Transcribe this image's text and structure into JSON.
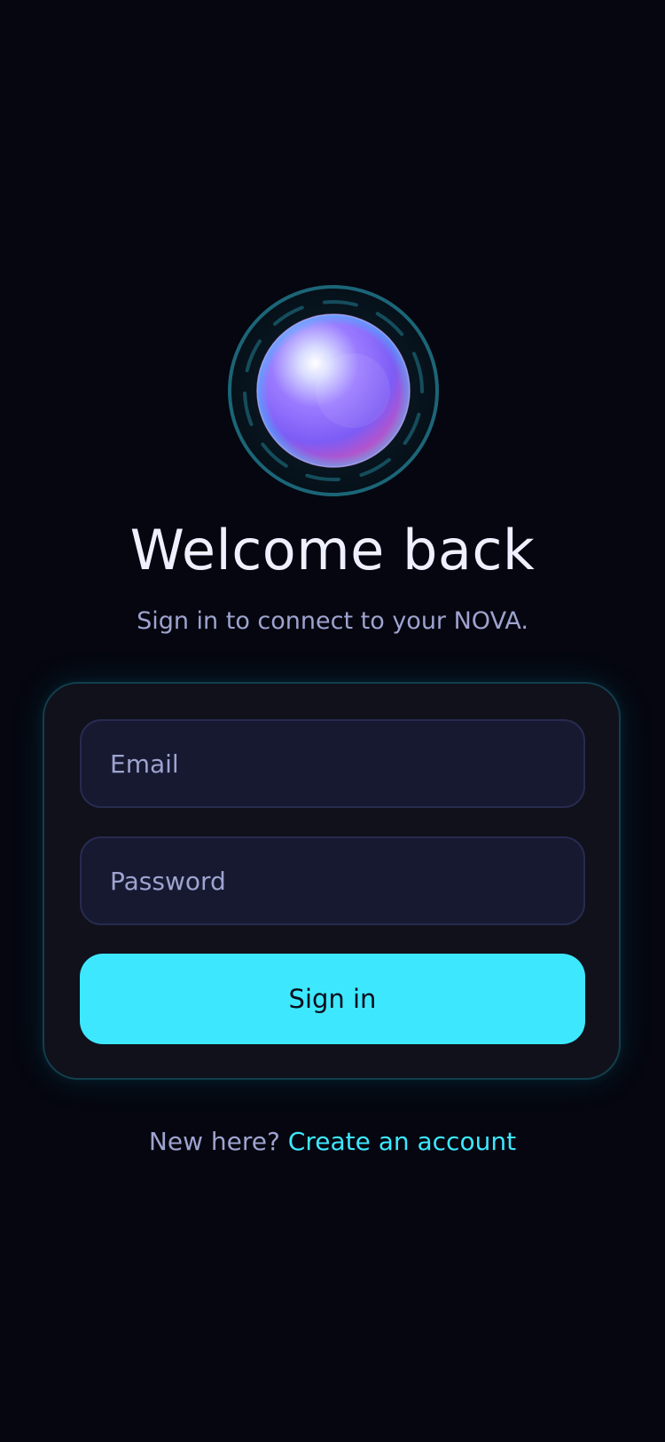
{
  "logo": {
    "icon": "orb-logo-icon"
  },
  "header": {
    "title": "Welcome back",
    "subtitle": "Sign in to connect to your NOVA."
  },
  "form": {
    "email_placeholder": "Email",
    "password_placeholder": "Password",
    "submit_label": "Sign in"
  },
  "footer": {
    "prompt": "New here?",
    "link_label": "Create an account"
  },
  "colors": {
    "background": "#05060f",
    "card": "#10111b",
    "accent": "#3de8ff",
    "muted_text": "#9ea3cf"
  }
}
